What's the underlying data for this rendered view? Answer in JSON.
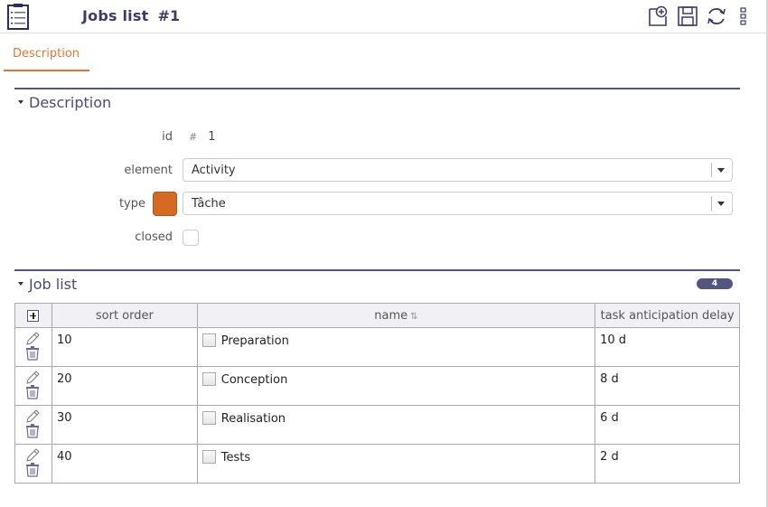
{
  "header": {
    "app_icon": "clipboard-list-icon",
    "title": "Jobs list",
    "record_number": "#1",
    "toolbar": [
      {
        "name": "new-item-icon",
        "label": "New"
      },
      {
        "name": "save-icon",
        "label": "Save"
      },
      {
        "name": "refresh-icon",
        "label": "Refresh"
      },
      {
        "name": "more-options-icon",
        "label": "More"
      }
    ]
  },
  "tabs": [
    {
      "label": "Description",
      "active": true
    }
  ],
  "description_section": {
    "title": "Description",
    "fields": {
      "id": {
        "label": "id",
        "prefix": "#",
        "value": "1"
      },
      "element": {
        "label": "element",
        "value": "Activity"
      },
      "type": {
        "label": "type",
        "value": "Tâche",
        "color": "#d66a22"
      },
      "closed": {
        "label": "closed",
        "checked": false
      }
    }
  },
  "job_list_section": {
    "title": "Job list",
    "count": "4",
    "columns": {
      "sort_order": "sort order",
      "name": "name",
      "name_sort_glyph": "⇅",
      "delay": "task anticipation delay"
    },
    "rows": [
      {
        "sort_order": "10",
        "name": "Preparation",
        "delay": "10 d"
      },
      {
        "sort_order": "20",
        "name": "Conception",
        "delay": "8 d"
      },
      {
        "sort_order": "30",
        "name": "Realisation",
        "delay": "6 d"
      },
      {
        "sort_order": "40",
        "name": "Tests",
        "delay": "2 d"
      }
    ]
  },
  "colors": {
    "accent": "#e2782e",
    "primary": "#545480",
    "title": "#3b3b6b"
  }
}
